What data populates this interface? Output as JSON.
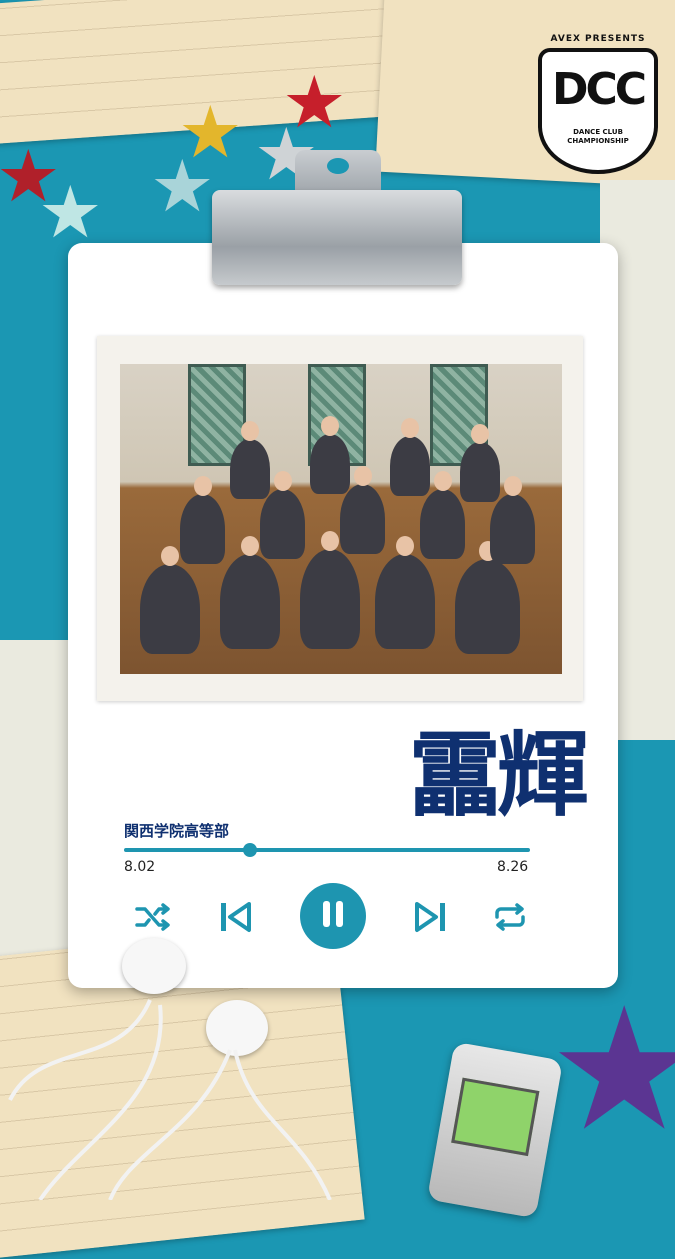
{
  "song": {
    "title": "靁輝",
    "artist": "関西学院高等部"
  },
  "player": {
    "time_elapsed": "8.02",
    "time_total": "8.26",
    "progress": 0.31
  },
  "controls": {
    "shuffle": "shuffle-icon",
    "previous": "skip-previous-icon",
    "pause": "pause-icon",
    "next": "skip-next-icon",
    "repeat": "repeat-icon"
  },
  "logo": {
    "top": "AVEX PRESENTS",
    "main": "DCC",
    "sub_line1": "DANCE CLUB",
    "sub_line2": "CHAMPIONSHIP"
  },
  "colors": {
    "accent": "#1e95b0",
    "title": "#0f3070",
    "background": "#1b97b3"
  }
}
